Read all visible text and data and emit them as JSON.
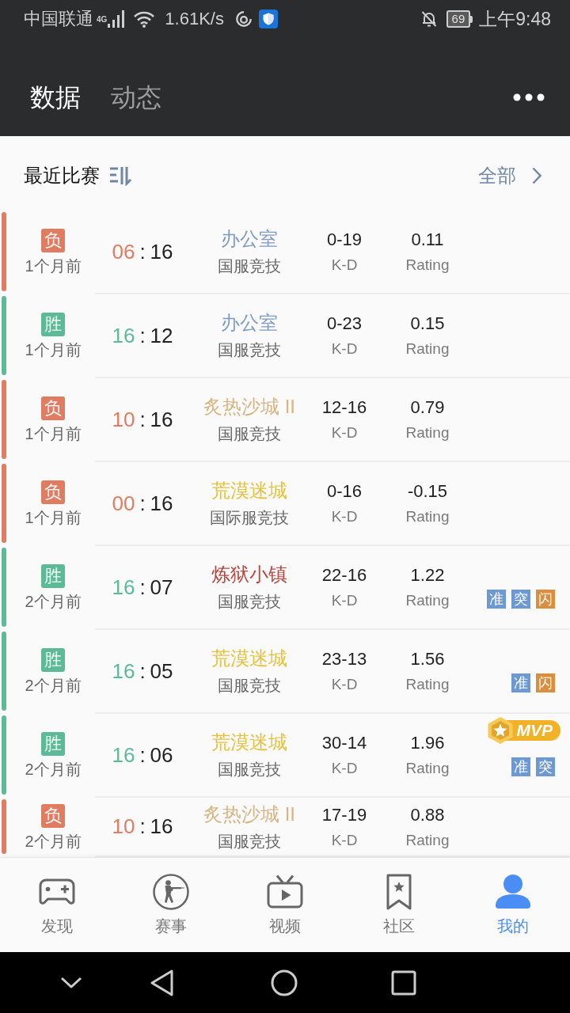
{
  "status_bar": {
    "carrier": "中国联通",
    "network": "4G",
    "speed": "1.61K/s",
    "battery": "69",
    "time": "上午9:48"
  },
  "header": {
    "tabs": [
      {
        "label": "数据",
        "selected": true
      },
      {
        "label": "动态",
        "selected": false
      }
    ]
  },
  "section": {
    "title": "最近比赛",
    "link": "全部"
  },
  "matches": [
    {
      "result": "负",
      "win": false,
      "time": "1个月前",
      "score_own": "06",
      "separator": ":",
      "score_opp": "16",
      "map": "办公室",
      "color": "#7e9cc2",
      "mode": "国服竞技",
      "kd": "0-19",
      "kd_label": "K-D",
      "rating": "0.11",
      "rating_label": "Rating"
    },
    {
      "result": "胜",
      "win": true,
      "time": "1个月前",
      "score_own": "16",
      "separator": ":",
      "score_opp": "12",
      "map": "办公室",
      "color": "#7e9cc2",
      "mode": "国服竞技",
      "kd": "0-23",
      "kd_label": "K-D",
      "rating": "0.15",
      "rating_label": "Rating"
    },
    {
      "result": "负",
      "win": false,
      "time": "1个月前",
      "score_own": "10",
      "separator": ":",
      "score_opp": "16",
      "map": "炙热沙城 II",
      "color": "#d6b583",
      "mode": "国服竞技",
      "kd": "12-16",
      "kd_label": "K-D",
      "rating": "0.79",
      "rating_label": "Rating"
    },
    {
      "result": "负",
      "win": false,
      "time": "1个月前",
      "score_own": "00",
      "separator": ":",
      "score_opp": "16",
      "map": "荒漠迷城",
      "color": "#e4c23e",
      "mode": "国际服竞技",
      "kd": "0-16",
      "kd_label": "K-D",
      "rating": "-0.15",
      "rating_label": "Rating"
    },
    {
      "result": "胜",
      "win": true,
      "time": "2个月前",
      "score_own": "16",
      "separator": ":",
      "score_opp": "07",
      "map": "炼狱小镇",
      "color": "#b8453f",
      "mode": "国服竞技",
      "kd": "22-16",
      "kd_label": "K-D",
      "rating": "1.22",
      "rating_label": "Rating",
      "tags": [
        {
          "label": "准",
          "color": "#6c98d4"
        },
        {
          "label": "突",
          "color": "#6c98d4"
        },
        {
          "label": "闪",
          "color": "#d98f3f"
        }
      ]
    },
    {
      "result": "胜",
      "win": true,
      "time": "2个月前",
      "score_own": "16",
      "separator": ":",
      "score_opp": "05",
      "map": "荒漠迷城",
      "color": "#e4c23e",
      "mode": "国服竞技",
      "kd": "23-13",
      "kd_label": "K-D",
      "rating": "1.56",
      "rating_label": "Rating",
      "tags": [
        {
          "label": "准",
          "color": "#6c98d4"
        },
        {
          "label": "闪",
          "color": "#d98f3f"
        }
      ]
    },
    {
      "result": "胜",
      "win": true,
      "time": "2个月前",
      "score_own": "16",
      "separator": ":",
      "score_opp": "06",
      "map": "荒漠迷城",
      "color": "#e4c23e",
      "mode": "国服竞技",
      "kd": "30-14",
      "kd_label": "K-D",
      "rating": "1.96",
      "rating_label": "Rating",
      "mvp_badge": "MVP",
      "tags": [
        {
          "label": "准",
          "color": "#6c98d4"
        },
        {
          "label": "突",
          "color": "#6c98d4"
        }
      ]
    },
    {
      "result": "负",
      "win": false,
      "time": "2个月前",
      "score_own": "10",
      "separator": ":",
      "score_opp": "16",
      "map": "炙热沙城 II",
      "color": "#d6b583",
      "mode": "国服竞技",
      "kd": "17-19",
      "kd_label": "K-D",
      "rating": "0.88",
      "rating_label": "Rating"
    }
  ],
  "bottom_nav": {
    "items": [
      {
        "label": "发现",
        "selected": false
      },
      {
        "label": "赛事",
        "selected": false
      },
      {
        "label": "视频",
        "selected": false
      },
      {
        "label": "社区",
        "selected": false
      },
      {
        "label": "我的",
        "selected": true
      }
    ]
  }
}
